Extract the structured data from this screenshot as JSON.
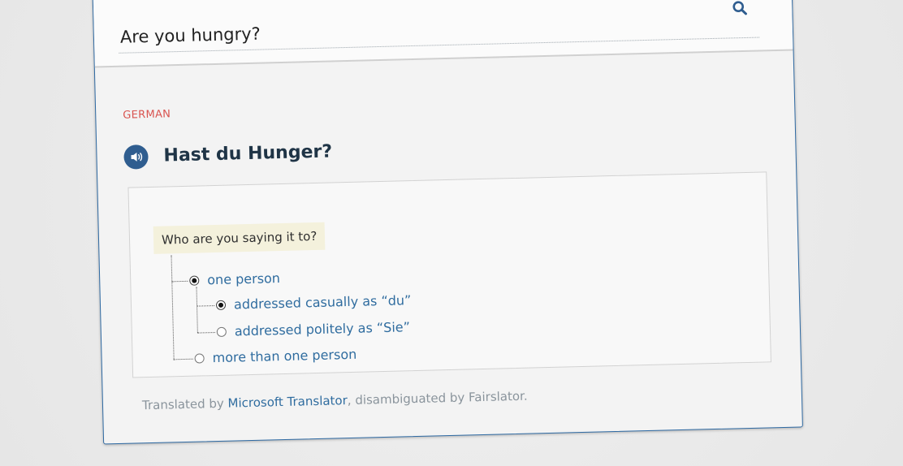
{
  "search": {
    "value": "Are you hungry?",
    "icon": "search-icon"
  },
  "result": {
    "language_label": "GERMAN",
    "speaker_icon": "speaker-icon",
    "translation": "Hast du Hunger?"
  },
  "disambiguation": {
    "question": "Who are you saying it to?",
    "options": [
      {
        "label": "one person",
        "selected": true
      },
      {
        "label": "addressed casually as “du”",
        "selected": true
      },
      {
        "label": "addressed politely as “Sie”",
        "selected": false
      },
      {
        "label": "more than one person",
        "selected": false
      }
    ]
  },
  "footer": {
    "prefix": "Translated by ",
    "link_text": "Microsoft Translator",
    "suffix": ", disambiguated by Fairslator."
  },
  "colors": {
    "accent": "#2f6c9f",
    "language_label": "#d9534f",
    "speaker_bg": "#2f5d8f",
    "question_bg": "#f4f1dc"
  }
}
